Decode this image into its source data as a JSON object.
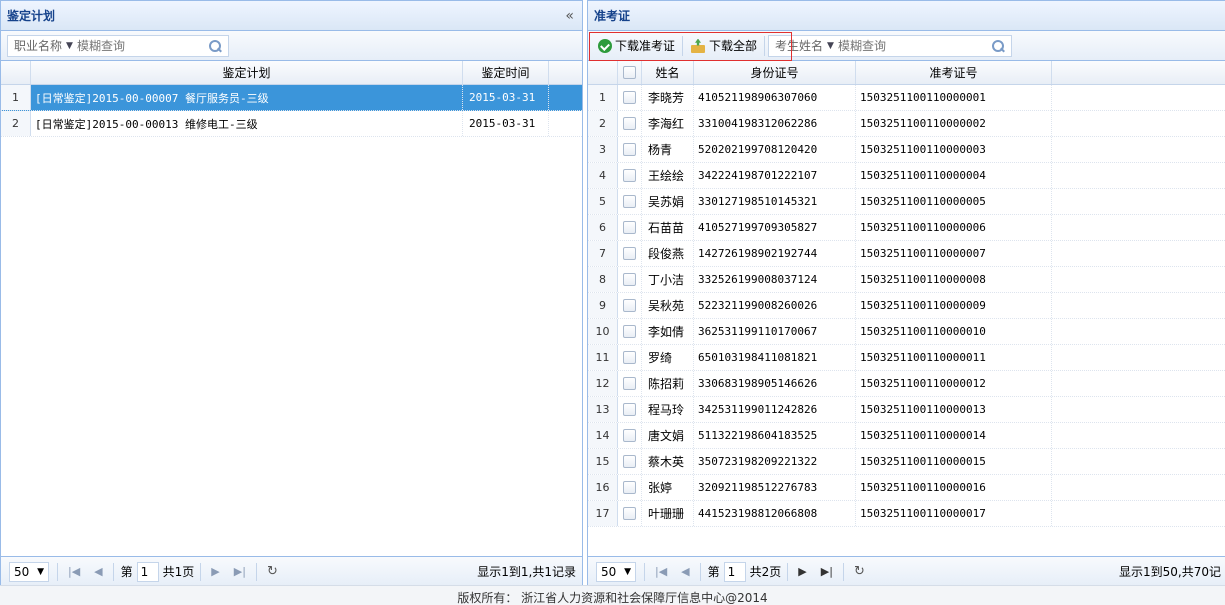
{
  "left_panel": {
    "title": "鉴定计划",
    "collapse_glyph": "«",
    "search": {
      "field_label": "职业名称",
      "placeholder": "模糊查询"
    },
    "columns": [
      "鉴定计划",
      "鉴定时间"
    ],
    "rows": [
      {
        "num": "1",
        "plan": "[日常鉴定]2015-00-00007 餐厅服务员-三级",
        "date": "2015-03-31",
        "selected": true
      },
      {
        "num": "2",
        "plan": "[日常鉴定]2015-00-00013 维修电工-三级",
        "date": "2015-03-31",
        "selected": false
      }
    ],
    "pager": {
      "page_size": "50",
      "page_prefix": "第",
      "page_value": "1",
      "total_pages": "共1页",
      "info": "显示1到1,共1记录"
    }
  },
  "right_panel": {
    "title": "准考证",
    "toolbar": {
      "download_label": "下载准考证",
      "download_all_label": "下载全部",
      "field_label": "考生姓名",
      "placeholder": "模糊查询"
    },
    "columns": [
      "姓名",
      "身份证号",
      "准考证号"
    ],
    "rows": [
      {
        "num": "1",
        "name": "李晓芳",
        "id": "410521198906307060",
        "ticket": "1503251100110000001"
      },
      {
        "num": "2",
        "name": "李海红",
        "id": "331004198312062286",
        "ticket": "1503251100110000002"
      },
      {
        "num": "3",
        "name": "杨青",
        "id": "520202199708120420",
        "ticket": "1503251100110000003"
      },
      {
        "num": "4",
        "name": "王绘绘",
        "id": "342224198701222107",
        "ticket": "1503251100110000004"
      },
      {
        "num": "5",
        "name": "吴苏娟",
        "id": "330127198510145321",
        "ticket": "1503251100110000005"
      },
      {
        "num": "6",
        "name": "石苗苗",
        "id": "410527199709305827",
        "ticket": "1503251100110000006"
      },
      {
        "num": "7",
        "name": "段俊燕",
        "id": "142726198902192744",
        "ticket": "1503251100110000007"
      },
      {
        "num": "8",
        "name": "丁小洁",
        "id": "332526199008037124",
        "ticket": "1503251100110000008"
      },
      {
        "num": "9",
        "name": "吴秋苑",
        "id": "522321199008260026",
        "ticket": "1503251100110000009"
      },
      {
        "num": "10",
        "name": "李如倩",
        "id": "362531199110170067",
        "ticket": "1503251100110000010"
      },
      {
        "num": "11",
        "name": "罗绮",
        "id": "650103198411081821",
        "ticket": "1503251100110000011"
      },
      {
        "num": "12",
        "name": "陈招莉",
        "id": "330683198905146626",
        "ticket": "1503251100110000012"
      },
      {
        "num": "13",
        "name": "程马玲",
        "id": "342531199011242826",
        "ticket": "1503251100110000013"
      },
      {
        "num": "14",
        "name": "唐文娟",
        "id": "511322198604183525",
        "ticket": "1503251100110000014"
      },
      {
        "num": "15",
        "name": "蔡木英",
        "id": "350723198209221322",
        "ticket": "1503251100110000015"
      },
      {
        "num": "16",
        "name": "张婷",
        "id": "320921198512276783",
        "ticket": "1503251100110000016"
      },
      {
        "num": "17",
        "name": "叶珊珊",
        "id": "441523198812066808",
        "ticket": "1503251100110000017"
      }
    ],
    "pager": {
      "page_size": "50",
      "page_prefix": "第",
      "page_value": "1",
      "total_pages": "共2页",
      "info": "显示1到50,共70记"
    }
  },
  "footer": {
    "text": "版权所有：  浙江省人力资源和社会保障厅信息中心@2014"
  },
  "colors": {
    "header_text": "#15428b",
    "selected_row": "#3b95da",
    "highlight_border": "#e03030",
    "border": "#99bbe8"
  }
}
